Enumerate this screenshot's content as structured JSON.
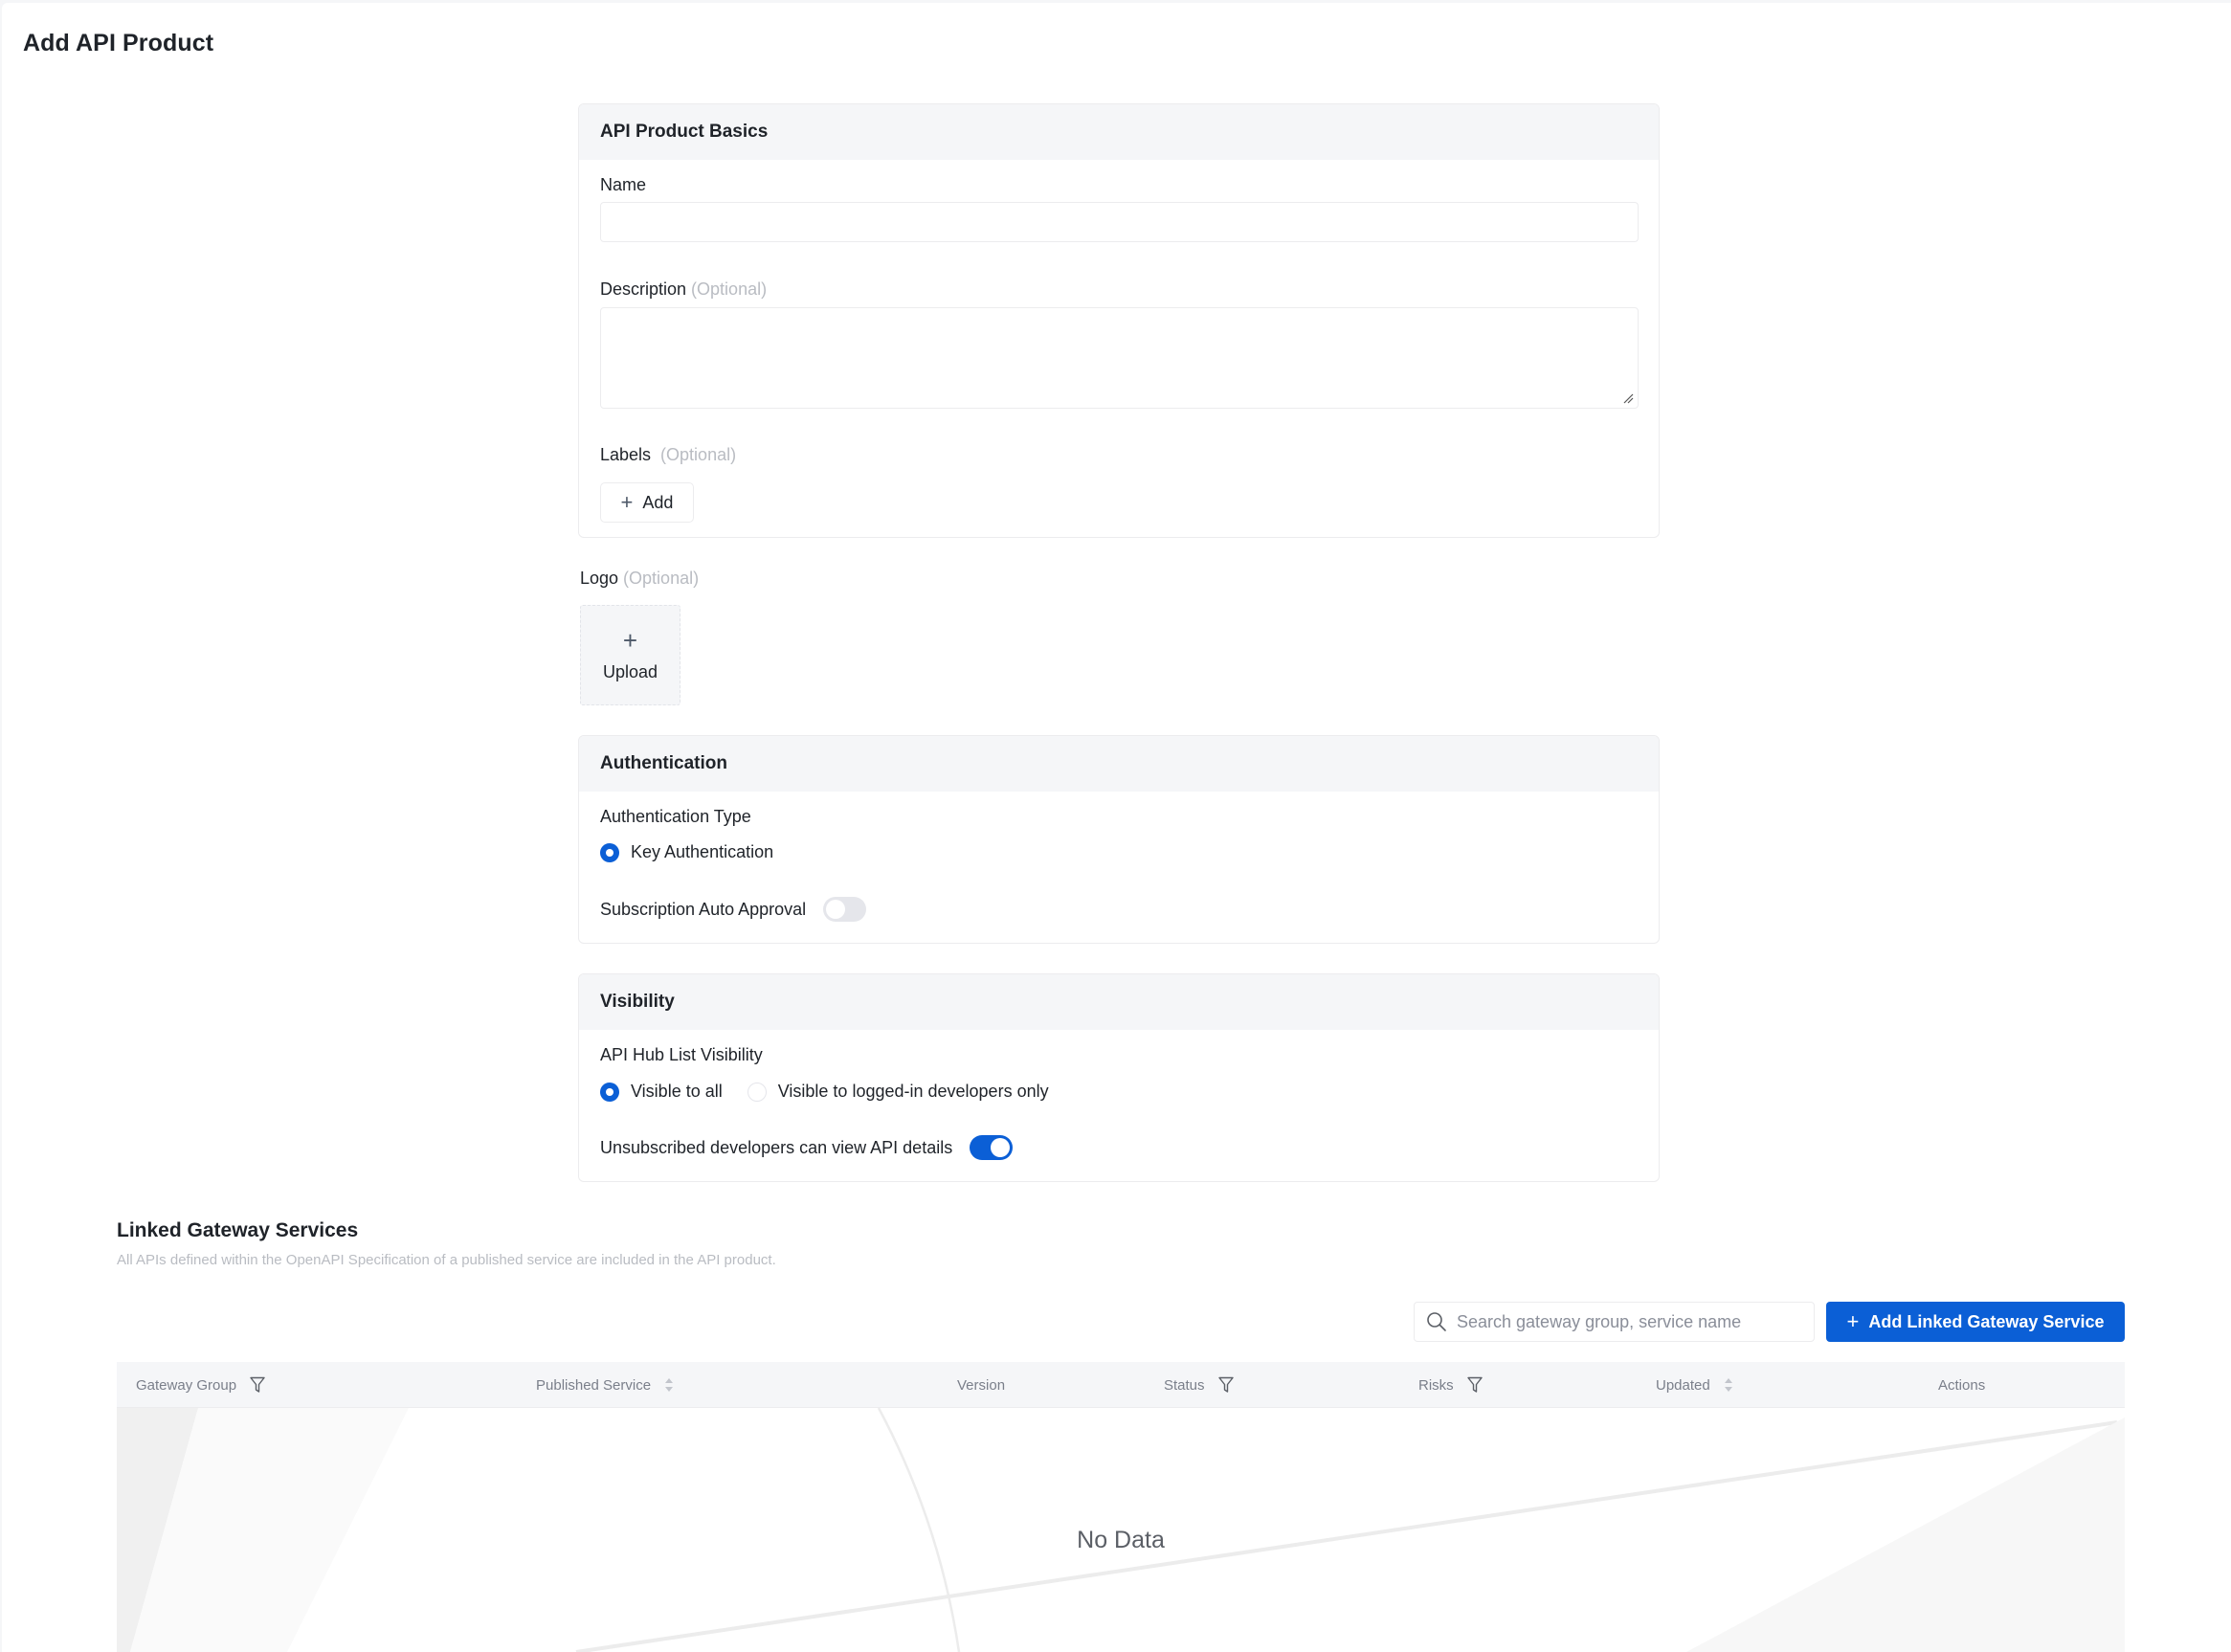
{
  "page": {
    "title": "Add API Product"
  },
  "basics": {
    "header": "API Product Basics",
    "name_label": "Name",
    "name_value": "",
    "description_label": "Description",
    "description_optional": "(Optional)",
    "description_value": "",
    "labels_label": "Labels",
    "labels_optional": "(Optional)",
    "add_label": "Add"
  },
  "logo": {
    "label": "Logo",
    "optional": "(Optional)",
    "upload_label": "Upload"
  },
  "authentication": {
    "header": "Authentication",
    "type_label": "Authentication Type",
    "options": [
      {
        "label": "Key Authentication",
        "checked": true
      }
    ],
    "auto_approval_label": "Subscription Auto Approval",
    "auto_approval_on": false
  },
  "visibility": {
    "header": "Visibility",
    "list_visibility_label": "API Hub List Visibility",
    "options": [
      {
        "label": "Visible to all",
        "checked": true
      },
      {
        "label": "Visible to logged-in developers only",
        "checked": false
      }
    ],
    "unsubscribed_label": "Unsubscribed developers can view API details",
    "unsubscribed_on": true
  },
  "linked_services": {
    "title": "Linked Gateway Services",
    "subtitle": "All APIs defined within the OpenAPI Specification of a published service are included in the API product.",
    "search_placeholder": "Search gateway group, service name",
    "search_value": "",
    "add_button": "Add Linked Gateway Service",
    "columns": [
      {
        "label": "Gateway Group",
        "icon": "filter-icon"
      },
      {
        "label": "Published Service",
        "icon": "sort-icon"
      },
      {
        "label": "Version",
        "icon": ""
      },
      {
        "label": "Status",
        "icon": "filter-icon"
      },
      {
        "label": "Risks",
        "icon": "filter-icon"
      },
      {
        "label": "Updated",
        "icon": "sort-icon"
      },
      {
        "label": "Actions",
        "icon": ""
      }
    ],
    "rows": [],
    "empty_text": "No Data"
  },
  "colors": {
    "primary": "#0b5fd6",
    "header_bg": "#f5f6f8",
    "optional_text": "#b9bcc2"
  }
}
